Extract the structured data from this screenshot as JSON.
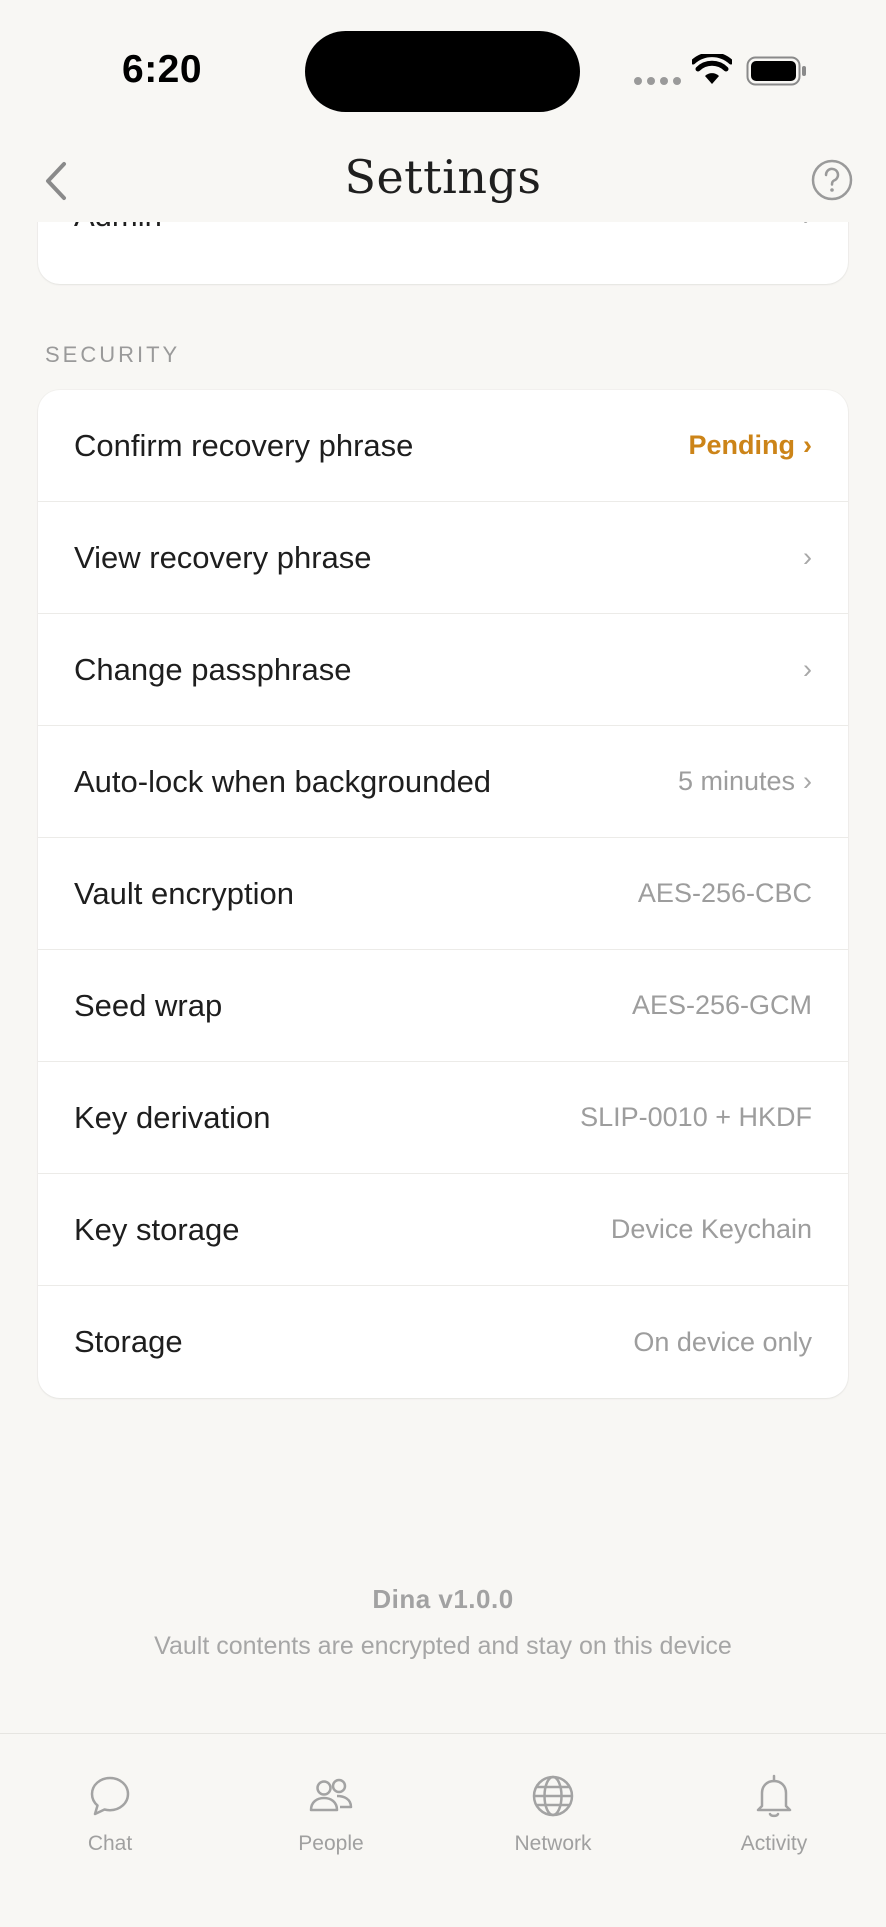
{
  "status_bar": {
    "time": "6:20"
  },
  "nav": {
    "title": "Settings"
  },
  "previous_section": {
    "last_item_label": "Admin",
    "chevron": "›"
  },
  "security": {
    "header": "SECURITY",
    "items": [
      {
        "label": "Confirm recovery phrase",
        "value": "Pending",
        "chevron": "›",
        "status_color": "#cc8418"
      },
      {
        "label": "View recovery phrase",
        "value": "",
        "chevron": "›"
      },
      {
        "label": "Change passphrase",
        "value": "",
        "chevron": "›"
      },
      {
        "label": "Auto-lock when backgrounded",
        "value": "5 minutes",
        "chevron": "›"
      },
      {
        "label": "Vault encryption",
        "value": "AES-256-CBC",
        "chevron": ""
      },
      {
        "label": "Seed wrap",
        "value": "AES-256-GCM",
        "chevron": ""
      },
      {
        "label": "Key derivation",
        "value": "SLIP-0010 + HKDF",
        "chevron": ""
      },
      {
        "label": "Key storage",
        "value": "Device Keychain",
        "chevron": ""
      },
      {
        "label": "Storage",
        "value": "On device only",
        "chevron": ""
      }
    ]
  },
  "footer": {
    "app_version": "Dina v1.0.0",
    "note": "Vault contents are encrypted and stay on this device"
  },
  "tab_bar": {
    "tabs": [
      {
        "label": "Chat",
        "icon": "chat-bubble-icon"
      },
      {
        "label": "People",
        "icon": "people-icon"
      },
      {
        "label": "Network",
        "icon": "globe-icon"
      },
      {
        "label": "Activity",
        "icon": "bell-icon"
      }
    ]
  },
  "colors": {
    "background": "#f8f7f4",
    "card": "#ffffff",
    "accent_pending": "#cc8418",
    "secondary_text": "#9d9d9d"
  }
}
